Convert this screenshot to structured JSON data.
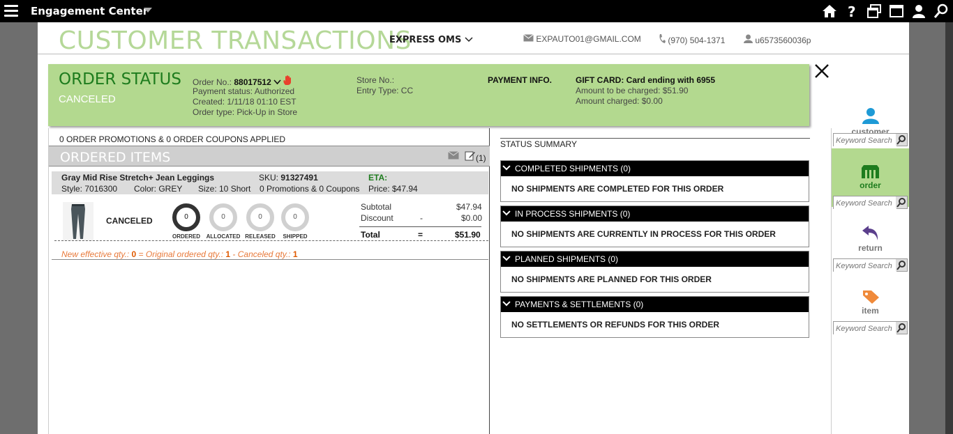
{
  "app": {
    "title": "Engagement Center"
  },
  "header": {
    "page_title": "CUSTOMER TRANSACTIONS",
    "channel": "EXPRESS OMS",
    "email": "EXPAUTO01@GMAIL.COM",
    "phone": "(970) 504-1371",
    "user": "u6573560036p"
  },
  "order_status": {
    "label": "ORDER STATUS",
    "state": "CANCELED",
    "order_no_label": "Order No.:",
    "order_no": "88017512",
    "payment_status": "Payment status:  Authorized",
    "created": "Created:   1/11/18 01:10 EST",
    "order_type": "Order type:  Pick-Up in Store",
    "store_no": "Store No.:",
    "entry_type": "Entry Type: CC",
    "payment_info": "PAYMENT INFO.",
    "gift_card": "GIFT CARD: Card ending with 6955",
    "to_be_charged": "Amount to be charged:   $51.90",
    "charged": "Amount charged: $0.00"
  },
  "promos": "0  ORDER PROMOTIONS &  0  ORDER COUPONS  APPLIED",
  "ordered_items": {
    "title": "ORDERED ITEMS",
    "notes_count": "(1)"
  },
  "item": {
    "name": "Gray Mid Rise Stretch+ Jean Leggings",
    "sku_label": "SKU:",
    "sku": "91327491",
    "eta": "ETA:",
    "style": "Style: 7016300",
    "color": "Color: GREY",
    "size": "Size:  10 Short",
    "promos": "0 Promotions & 0 Coupons",
    "price": "Price:  $47.94",
    "state": "CANCELED",
    "stages": [
      {
        "label": "ORDERED",
        "qty": "0"
      },
      {
        "label": "ALLOCATED",
        "qty": "0"
      },
      {
        "label": "RELEASED",
        "qty": "0"
      },
      {
        "label": "SHIPPED",
        "qty": "0"
      }
    ],
    "subtotal_label": "Subtotal",
    "subtotal": "$47.94",
    "discount_label": "Discount",
    "discount_sign": "-",
    "discount": "$0.00",
    "total_label": "Total",
    "total_eq": "=",
    "total": "$51.90",
    "eff": {
      "a": "New effective qty.:",
      "a_v": "0",
      "b": "=  Original ordered qty.:",
      "b_v": "1",
      "c": "-  Canceled qty.:",
      "c_v": "1"
    }
  },
  "status_summary": {
    "title": "STATUS SUMMARY",
    "sections": [
      {
        "title": "COMPLETED SHIPMENTS (0)",
        "body": "NO SHIPMENTS ARE COMPLETED FOR THIS ORDER"
      },
      {
        "title": "IN PROCESS SHIPMENTS (0)",
        "body": "NO SHIPMENTS ARE CURRENTLY IN PROCESS FOR THIS ORDER"
      },
      {
        "title": "PLANNED SHIPMENTS (0)",
        "body": "NO SHIPMENTS ARE PLANNED FOR THIS ORDER"
      },
      {
        "title": "PAYMENTS & SETTLEMENTS (0)",
        "body": "NO SETTLEMENTS OR REFUNDS FOR THIS ORDER"
      }
    ]
  },
  "sidebar": {
    "items": [
      {
        "label": "customer",
        "icon": "person-icon"
      },
      {
        "label": "order",
        "icon": "store-icon"
      },
      {
        "label": "return",
        "icon": "return-arrow-icon"
      },
      {
        "label": "item",
        "icon": "tag-icon"
      }
    ],
    "search_placeholder": "Keyword Search"
  },
  "colors": {
    "accent_green": "#b3d98f",
    "dark_green": "#1e7c1e",
    "customer_blue": "#1e9ad6",
    "return_purple": "#5b3f8c",
    "item_orange": "#f08a3a",
    "alert_red": "#e8412c"
  }
}
